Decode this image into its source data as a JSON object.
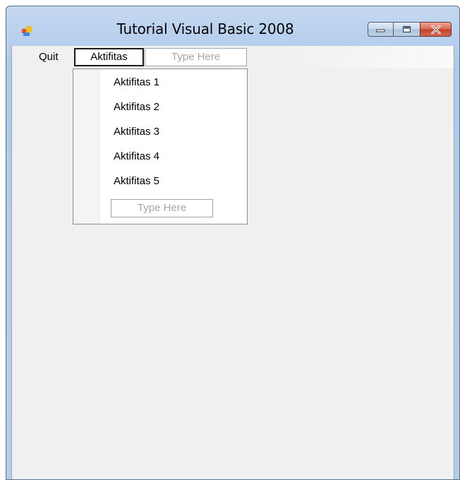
{
  "window": {
    "title": "Tutorial Visual Basic 2008",
    "app_icon": "vb-form-icon",
    "caption_buttons": {
      "minimize_icon": "minimize-icon",
      "maximize_icon": "maximize-icon",
      "close_icon": "close-icon"
    }
  },
  "menubar": {
    "quit_label": "Quit",
    "aktifitas_label": "Aktifitas",
    "type_here_placeholder": "Type Here"
  },
  "dropdown": {
    "items": [
      {
        "label": "Aktifitas 1"
      },
      {
        "label": "Aktifitas 2"
      },
      {
        "label": "Aktifitas 3"
      },
      {
        "label": "Aktifitas 4"
      },
      {
        "label": "Aktifitas 5"
      }
    ],
    "type_here_placeholder": "Type Here"
  },
  "colors": {
    "frame": "#b9d1ee",
    "client": "#f0f0f0",
    "close_button": "#c4402a",
    "placeholder_text": "#a6a6a6"
  }
}
